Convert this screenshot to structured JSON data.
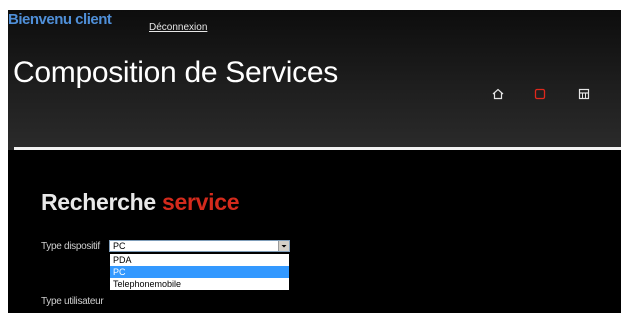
{
  "header": {
    "welcome": "Bienvenu client",
    "logout": "Déconnexion",
    "title": "Composition de Services",
    "nav": [
      {
        "icon": "home-icon",
        "color": "#e6e6e6"
      },
      {
        "icon": "square-icon",
        "color": "#e0281c"
      },
      {
        "icon": "grid-icon",
        "color": "#e6e6e6"
      }
    ]
  },
  "section": {
    "title_part1": "Recherche ",
    "title_part2": "service",
    "accent_color": "#d42a1c"
  },
  "form": {
    "device_type_label": "Type dispositif",
    "device_type_value": "PC",
    "device_type_options": [
      "PDA",
      "PC",
      "Telephonemobile"
    ],
    "device_type_highlighted": "PC",
    "user_type_label": "Type utilisateur"
  }
}
